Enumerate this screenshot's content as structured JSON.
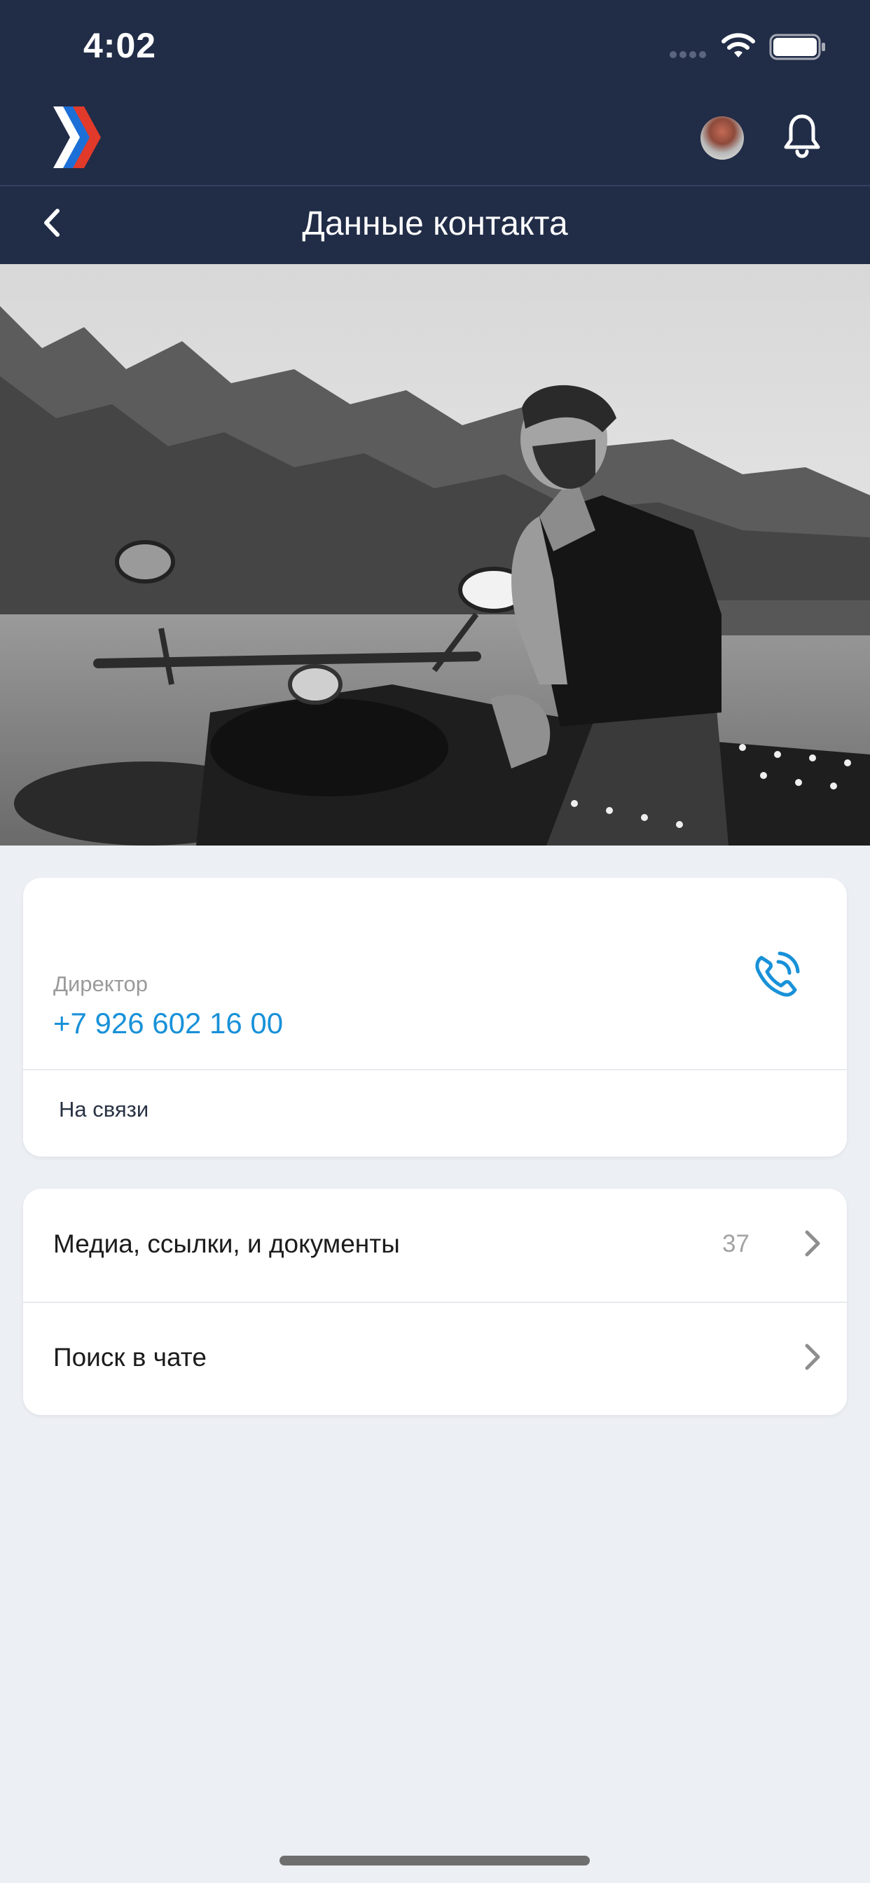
{
  "status_bar": {
    "time": "4:02"
  },
  "nav": {
    "title": "Данные контакта"
  },
  "contact": {
    "role": "Директор",
    "phone": "+7 926 602 16 00",
    "status": "На связи"
  },
  "menu": {
    "items": [
      {
        "label": "Медиа, ссылки, и документы",
        "count": "37"
      },
      {
        "label": "Поиск в чате",
        "count": ""
      }
    ]
  },
  "colors": {
    "header_bg": "#212c47",
    "accent": "#1891d8",
    "page_bg": "#eceff4"
  },
  "icons": [
    "app-logo-icon",
    "wifi-icon",
    "battery-icon",
    "bell-icon",
    "back-arrow-icon",
    "phone-call-icon",
    "chevron-right-icon"
  ]
}
